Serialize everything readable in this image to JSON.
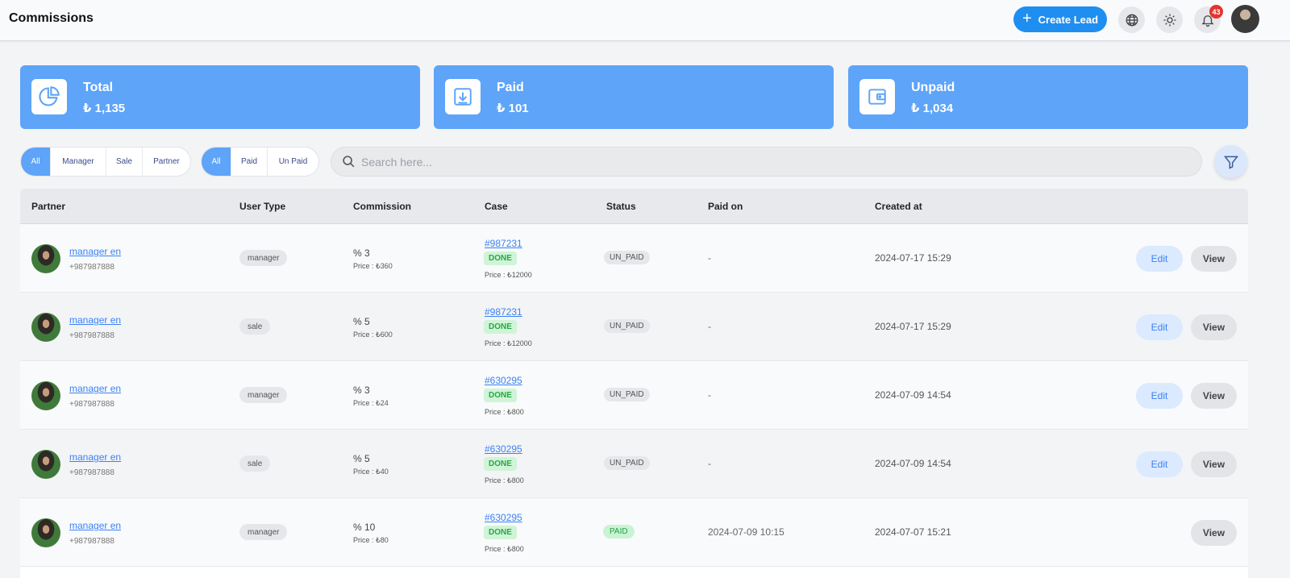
{
  "header": {
    "title": "Commissions",
    "create_lead_label": "Create Lead",
    "notification_count": "43"
  },
  "stats": [
    {
      "label": "Total",
      "value": "₺ 1,135",
      "icon": "pie-chart-icon"
    },
    {
      "label": "Paid",
      "value": "₺ 101",
      "icon": "download-icon"
    },
    {
      "label": "Unpaid",
      "value": "₺ 1,034",
      "icon": "wallet-icon"
    }
  ],
  "filters": {
    "user_type": [
      "All",
      "Manager",
      "Sale",
      "Partner"
    ],
    "user_type_selected": "All",
    "payment": [
      "All",
      "Paid",
      "Un Paid"
    ],
    "payment_selected": "All"
  },
  "search": {
    "placeholder": "Search here...",
    "value": ""
  },
  "table": {
    "headers": [
      "Partner",
      "User Type",
      "Commission",
      "Case",
      "Status",
      "Paid on",
      "Created at"
    ],
    "rows": [
      {
        "name": "manager en",
        "phone": "+987987888",
        "user_type": "manager",
        "commission": "% 3",
        "commission_price": "Price : ₺360",
        "case": "#987231",
        "case_status": "DONE",
        "case_price": "Price : ₺12000",
        "status": "UN_PAID",
        "paid_on": "-",
        "created_at": "2024-07-17 15:29",
        "edit": "Edit",
        "view": "View"
      },
      {
        "name": "manager en",
        "phone": "+987987888",
        "user_type": "sale",
        "commission": "% 5",
        "commission_price": "Price : ₺600",
        "case": "#987231",
        "case_status": "DONE",
        "case_price": "Price : ₺12000",
        "status": "UN_PAID",
        "paid_on": "-",
        "created_at": "2024-07-17 15:29",
        "edit": "Edit",
        "view": "View"
      },
      {
        "name": "manager en",
        "phone": "+987987888",
        "user_type": "manager",
        "commission": "% 3",
        "commission_price": "Price : ₺24",
        "case": "#630295",
        "case_status": "DONE",
        "case_price": "Price : ₺800",
        "status": "UN_PAID",
        "paid_on": "-",
        "created_at": "2024-07-09 14:54",
        "edit": "Edit",
        "view": "View"
      },
      {
        "name": "manager en",
        "phone": "+987987888",
        "user_type": "sale",
        "commission": "% 5",
        "commission_price": "Price : ₺40",
        "case": "#630295",
        "case_status": "DONE",
        "case_price": "Price : ₺800",
        "status": "UN_PAID",
        "paid_on": "-",
        "created_at": "2024-07-09 14:54",
        "edit": "Edit",
        "view": "View"
      },
      {
        "name": "manager en",
        "phone": "+987987888",
        "user_type": "manager",
        "commission": "% 10",
        "commission_price": "Price : ₺80",
        "case": "#630295",
        "case_status": "DONE",
        "case_price": "Price : ₺800",
        "status": "PAID",
        "paid_on": "2024-07-09 10:15",
        "created_at": "2024-07-07 15:21",
        "edit": "",
        "view": "View"
      }
    ]
  },
  "colors": {
    "accent": "#1f8ef1",
    "card": "#5ea4f8",
    "paid_green": "#27a04a"
  }
}
